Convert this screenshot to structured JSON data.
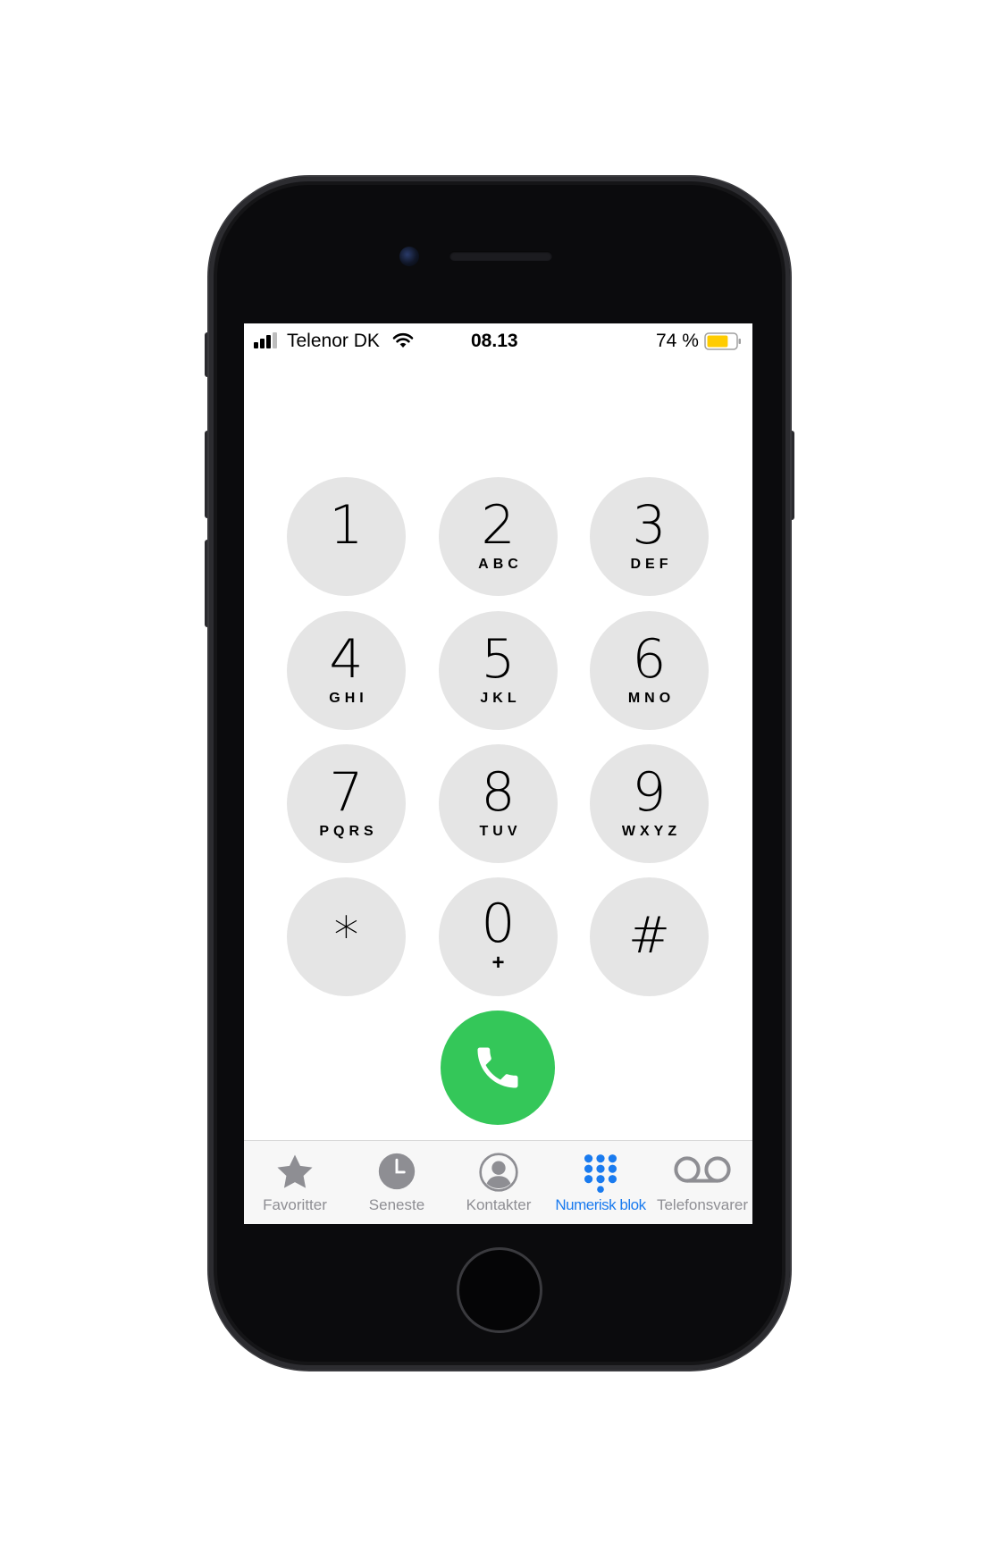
{
  "status_bar": {
    "carrier": "Telenor DK",
    "time": "08.13",
    "battery_percent": "74 %",
    "battery_level": 0.74,
    "battery_color": "#ffcc00",
    "signal_bars": 3,
    "signal_total": 4
  },
  "keypad": {
    "keys": [
      {
        "digit": "1",
        "letters": ""
      },
      {
        "digit": "2",
        "letters": "ABC"
      },
      {
        "digit": "3",
        "letters": "DEF"
      },
      {
        "digit": "4",
        "letters": "GHI"
      },
      {
        "digit": "5",
        "letters": "JKL"
      },
      {
        "digit": "6",
        "letters": "MNO"
      },
      {
        "digit": "7",
        "letters": "PQRS"
      },
      {
        "digit": "8",
        "letters": "TUV"
      },
      {
        "digit": "9",
        "letters": "WXYZ"
      },
      {
        "digit": "*",
        "letters": ""
      },
      {
        "digit": "0",
        "letters": "+"
      },
      {
        "digit": "#",
        "letters": ""
      }
    ],
    "key_color": "#e5e5e5",
    "call_button_color": "#34c759"
  },
  "tab_bar": {
    "tabs": [
      {
        "label": "Favoritter",
        "icon": "star-icon",
        "active": false
      },
      {
        "label": "Seneste",
        "icon": "clock-icon",
        "active": false
      },
      {
        "label": "Kontakter",
        "icon": "person-circle-icon",
        "active": false
      },
      {
        "label": "Numerisk blok",
        "icon": "keypad-grid-icon",
        "active": true
      },
      {
        "label": "Telefonsvarer",
        "icon": "voicemail-icon",
        "active": false
      }
    ],
    "active_color": "#1a7bef",
    "inactive_color": "#8e8e93"
  }
}
